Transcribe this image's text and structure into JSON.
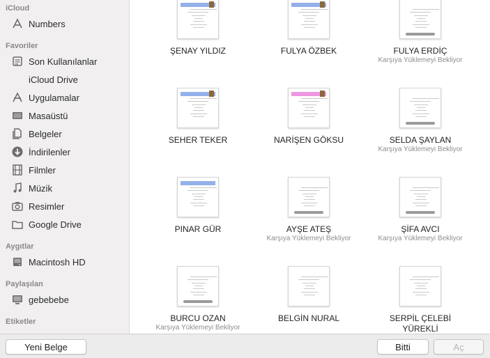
{
  "sidebar": {
    "sections": {
      "icloud": "iCloud",
      "favorites": "Favoriler",
      "devices": "Aygıtlar",
      "shared": "Paylaşılan",
      "tags": "Etiketler"
    },
    "icloud_items": [
      {
        "label": "Numbers",
        "icon": "numbers-app-icon"
      }
    ],
    "favorite_items": [
      {
        "label": "Son Kullanılanlar",
        "icon": "recents-icon"
      },
      {
        "label": "iCloud Drive",
        "icon": ""
      },
      {
        "label": "Uygulamalar",
        "icon": "applications-icon"
      },
      {
        "label": "Masaüstü",
        "icon": "desktop-icon"
      },
      {
        "label": "Belgeler",
        "icon": "documents-icon"
      },
      {
        "label": "İndirilenler",
        "icon": "downloads-icon"
      },
      {
        "label": "Filmler",
        "icon": "movies-icon"
      },
      {
        "label": "Müzik",
        "icon": "music-icon"
      },
      {
        "label": "Resimler",
        "icon": "pictures-icon"
      },
      {
        "label": "Google Drive",
        "icon": "folder-icon"
      }
    ],
    "device_items": [
      {
        "label": "Macintosh HD",
        "icon": "hard-drive-icon"
      }
    ],
    "shared_items": [
      {
        "label": "gebebebe",
        "icon": "computer-icon"
      }
    ]
  },
  "documents": [
    {
      "name": "ŞENAY YILDIZ",
      "status": "",
      "photo": true,
      "progress": false
    },
    {
      "name": "FULYA ÖZBEK",
      "status": "",
      "photo": true,
      "progress": false
    },
    {
      "name": "FULYA ERDİÇ",
      "status": "Karşıya Yüklemeyi Bekliyor",
      "photo": false,
      "progress": true
    },
    {
      "name": "SEHER TEKER",
      "status": "",
      "photo": true,
      "progress": false
    },
    {
      "name": "NARİŞEN GÖKSU",
      "status": "",
      "photo": true,
      "progress": false
    },
    {
      "name": "SELDA ŞAYLAN",
      "status": "Karşıya Yüklemeyi Bekliyor",
      "photo": false,
      "progress": true
    },
    {
      "name": "PINAR GÜR",
      "status": "",
      "photo": false,
      "progress": false
    },
    {
      "name": "AYŞE ATEŞ",
      "status": "Karşıya Yüklemeyi Bekliyor",
      "photo": false,
      "progress": true
    },
    {
      "name": "ŞİFA AVCI",
      "status": "Karşıya Yüklemeyi Bekliyor",
      "photo": false,
      "progress": true
    },
    {
      "name": "BURCU OZAN",
      "status": "Karşıya Yüklemeyi Bekliyor",
      "photo": false,
      "progress": true
    },
    {
      "name": "BELGİN NURAL",
      "status": "",
      "photo": false,
      "progress": false
    },
    {
      "name": "SERPİL ÇELEBİ",
      "name_line2": "YÜREKLİ",
      "status": "",
      "photo": false,
      "progress": false
    }
  ],
  "footer": {
    "new_document": "Yeni Belge",
    "done": "Bitti",
    "open": "Aç"
  },
  "colors": {
    "sidebar_bg": "#f1eff0",
    "thumb_header_blue": "#3a6fd8",
    "thumb_header_pink": "#e040c8"
  }
}
